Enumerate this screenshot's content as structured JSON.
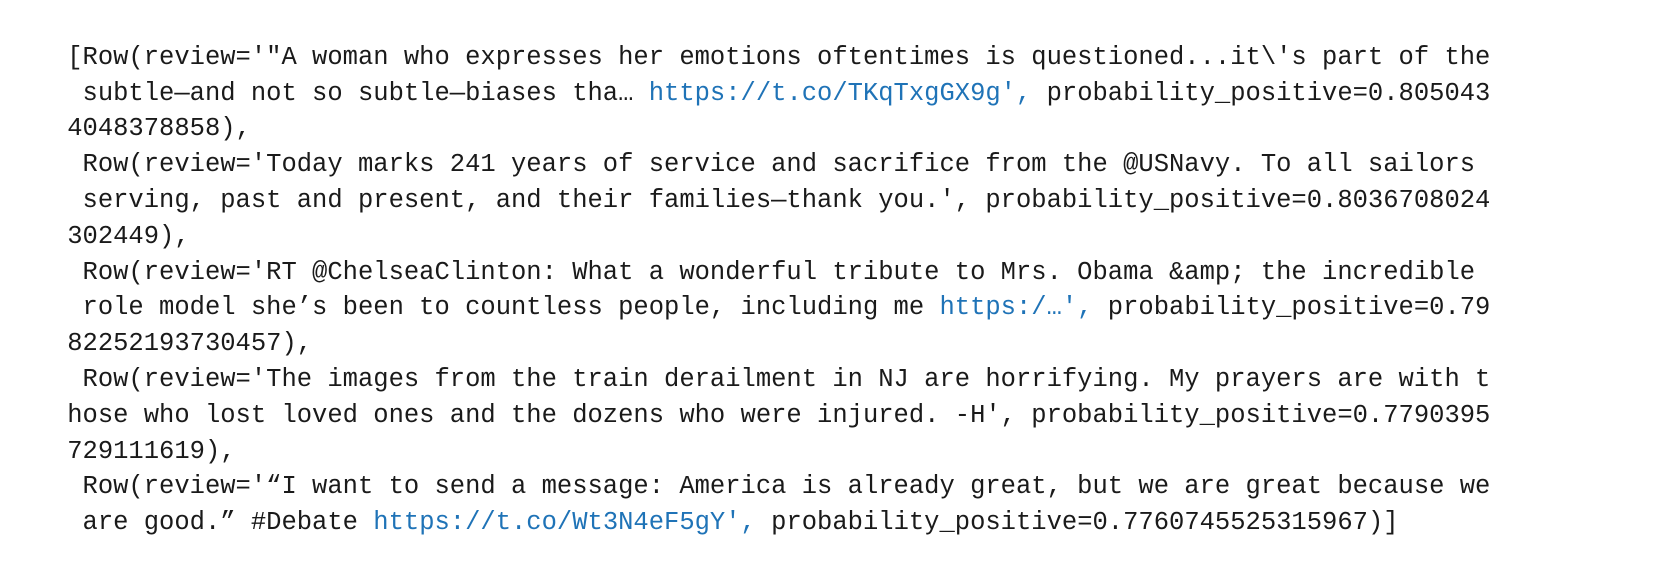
{
  "output": {
    "lines": [
      [
        {
          "text": "[Row(review='\"A woman who expresses her emotions oftentimes is questioned...it\\'s part of the",
          "link": false
        }
      ],
      [
        {
          "text": " subtle—and not so subtle—biases tha… ",
          "link": false
        },
        {
          "text": "https://t.co/TKqTxgGX9g',",
          "link": true
        },
        {
          "text": " probability_positive=0.805043",
          "link": false
        }
      ],
      [
        {
          "text": "4048378858),",
          "link": false
        }
      ],
      [
        {
          "text": " Row(review='Today marks 241 years of service and sacrifice from the @USNavy. To all sailors",
          "link": false
        }
      ],
      [
        {
          "text": " serving, past and present, and their families—thank you.', probability_positive=0.8036708024",
          "link": false
        }
      ],
      [
        {
          "text": "302449),",
          "link": false
        }
      ],
      [
        {
          "text": " Row(review='RT @ChelseaClinton: What a wonderful tribute to Mrs. Obama &amp; the incredible",
          "link": false
        }
      ],
      [
        {
          "text": " role model she’s been to countless people, including me ",
          "link": false
        },
        {
          "text": "https:/…',",
          "link": true
        },
        {
          "text": " probability_positive=0.79",
          "link": false
        }
      ],
      [
        {
          "text": "82252193730457),",
          "link": false
        }
      ],
      [
        {
          "text": " Row(review='The images from the train derailment in NJ are horrifying. My prayers are with t",
          "link": false
        }
      ],
      [
        {
          "text": "hose who lost loved ones and the dozens who were injured. -H', probability_positive=0.7790395",
          "link": false
        }
      ],
      [
        {
          "text": "729111619),",
          "link": false
        }
      ],
      [
        {
          "text": " Row(review='“I want to send a message: America is already great, but we are great because we",
          "link": false
        }
      ],
      [
        {
          "text": " are good.” #Debate ",
          "link": false
        },
        {
          "text": "https://t.co/Wt3N4eF5gY',",
          "link": true
        },
        {
          "text": " probability_positive=0.7760745525315967)]",
          "link": false
        }
      ]
    ]
  }
}
